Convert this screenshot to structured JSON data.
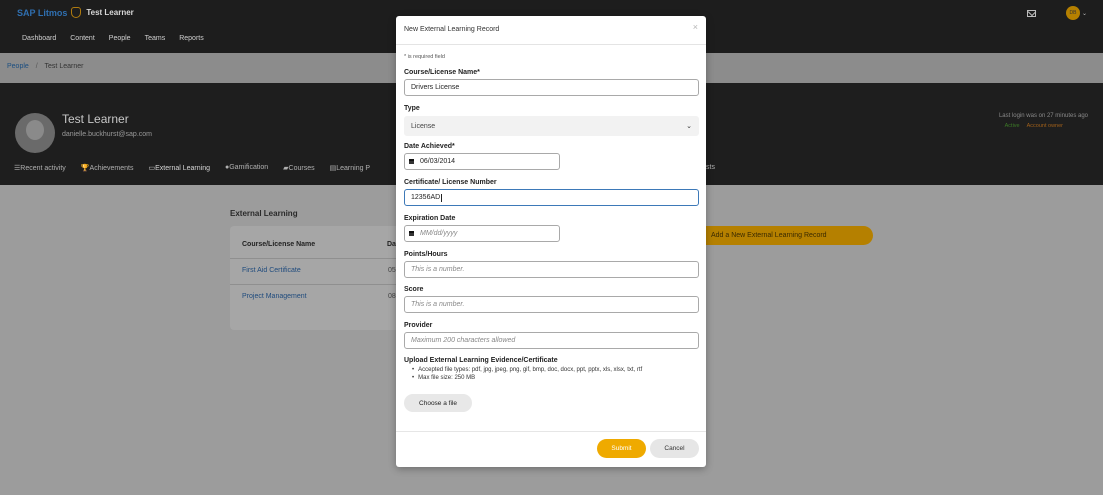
{
  "topbar": {
    "brand": "SAP Litmos",
    "learner_name": "Test Learner",
    "nav": [
      "Dashboard",
      "Content",
      "People",
      "Teams",
      "Reports"
    ],
    "avatar_initials": "DB"
  },
  "breadcrumb": {
    "link": "People",
    "sep": "/",
    "current": "Test Learner"
  },
  "profile": {
    "name": "Test Learner",
    "email": "danielle.buckhurst@sap.com",
    "last_login": "Last login was on 27 minutes ago",
    "status_active": "Active",
    "status_owner": "Account owner",
    "tabs": [
      "Recent activity",
      "Achievements",
      "External Learning",
      "Gamification",
      "Courses",
      "Learning P"
    ],
    "tab_right": "sts"
  },
  "external_learning": {
    "title": "External Learning",
    "col_name": "Course/License Name",
    "col_date": "Da",
    "rows": [
      {
        "name": "First Aid Certificate",
        "date": "05"
      },
      {
        "name": "Project Management",
        "date": "08"
      }
    ],
    "add_button": "Add a New External Learning Record"
  },
  "modal": {
    "title": "New External Learning Record",
    "close": "×",
    "required_note": "* is required field",
    "course_label": "Course/License Name*",
    "course_value": "Drivers License",
    "type_label": "Type",
    "type_value": "License",
    "date_label": "Date Achieved*",
    "date_value": "06/03/2014",
    "cert_label": "Certificate/ License Number",
    "cert_value": "12356AD",
    "exp_label": "Expiration Date",
    "exp_placeholder": "MM/dd/yyyy",
    "points_label": "Points/Hours",
    "points_placeholder": "This is a number.",
    "score_label": "Score",
    "score_placeholder": "This is a number.",
    "provider_label": "Provider",
    "provider_placeholder": "Maximum 200 characters allowed",
    "upload_label": "Upload External Learning Evidence/Certificate",
    "accepted_types": "Accepted file types: pdf, jpg, jpeg, png, gif, bmp, doc, docx, ppt, pptx, xls, xlsx, txt, rtf",
    "max_size": "Max file size: 250 MB",
    "choose_file": "Choose a file",
    "submit": "Submit",
    "cancel": "Cancel"
  }
}
